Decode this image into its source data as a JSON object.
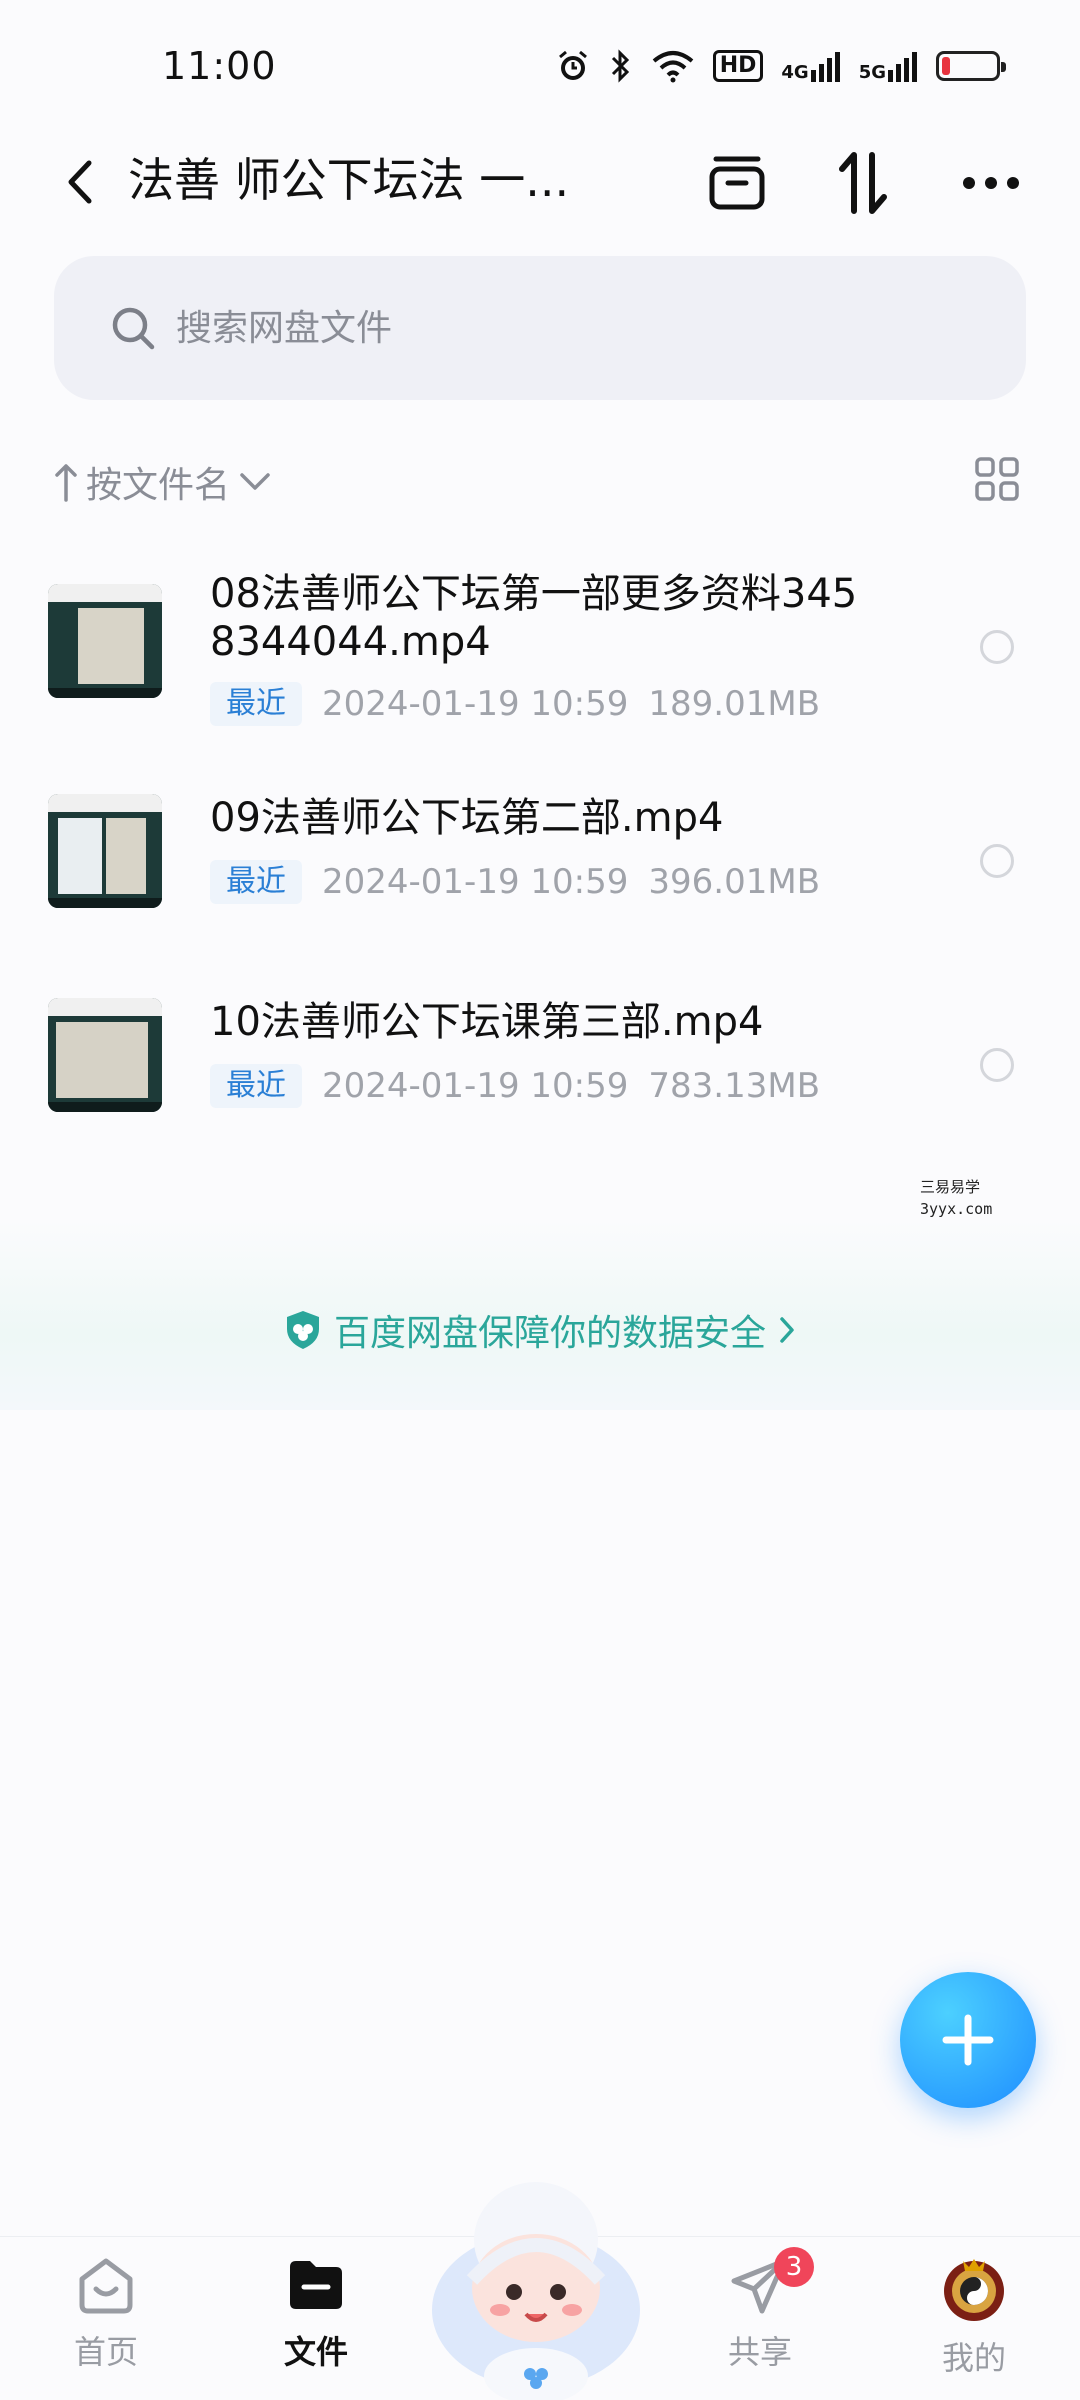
{
  "status_bar": {
    "time": "11:00",
    "hd": "HD",
    "net1": "4G",
    "net2": "5G",
    "battery_level": 0.15,
    "battery_color": "#e8343f"
  },
  "header": {
    "title": "法善 师公下坛法 一...",
    "icons": [
      "back-icon",
      "archive-icon",
      "sort-swap-icon",
      "more-icon"
    ]
  },
  "search": {
    "placeholder": "搜索网盘文件"
  },
  "sort": {
    "label": "按文件名",
    "icons": [
      "arrow-up-icon",
      "chevron-down-icon",
      "grid-view-icon"
    ]
  },
  "files": [
    {
      "name": "08法善师公下坛第一部更多资料3458344044.mp4",
      "badge": "最近",
      "date": "2024-01-19  10:59",
      "size": "189.01MB"
    },
    {
      "name": "09法善师公下坛第二部.mp4",
      "badge": "最近",
      "date": "2024-01-19  10:59",
      "size": "396.01MB"
    },
    {
      "name": "10法善师公下坛课第三部.mp4",
      "badge": "最近",
      "date": "2024-01-19  10:59",
      "size": "783.13MB"
    }
  ],
  "watermark": {
    "line1": "三易易学",
    "line2": "3yyx.com"
  },
  "security": {
    "text": "百度网盘保障你的数据安全"
  },
  "nav": {
    "home": "首页",
    "files": "文件",
    "share": "共享",
    "share_badge": "3",
    "me": "我的"
  },
  "colors": {
    "accent": "#1e8dff",
    "security_green": "#2aa69a",
    "badge_blue": "#2a7fd5",
    "notify_red": "#f0455a"
  }
}
